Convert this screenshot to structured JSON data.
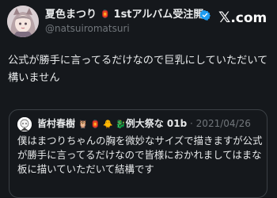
{
  "author": {
    "display_name": "夏色まつり",
    "name_emoji": "🏮",
    "name_suffix": " 1stアルバム受注開...",
    "handle": "@natsuiromatsuri",
    "verified_icon": "verified-badge-icon",
    "avatar": "user-avatar"
  },
  "brand": {
    "mark": "𝕏",
    "suffix": ".com"
  },
  "tweet": {
    "text": "公式が勝手に言ってるだけなので巨乳にしていただいて構いません"
  },
  "quote": {
    "name": "皆村春樹",
    "name_emojis": " 🦉 🏮 🐥 🐉",
    "name_suffix": "例大祭な 01b",
    "separator": " · ",
    "date": "2021/04/26",
    "text": "僕はまつりちゃんの胸を微妙なサイズで描きますが公式が勝手に言ってるだけなので皆様におかれましてはまな板に描いていただいて結構です"
  },
  "colors": {
    "background": "#15181c",
    "text": "#e7e9ea",
    "muted": "#71767b",
    "verified": "#1d9bf0",
    "border": "#3b4045"
  }
}
